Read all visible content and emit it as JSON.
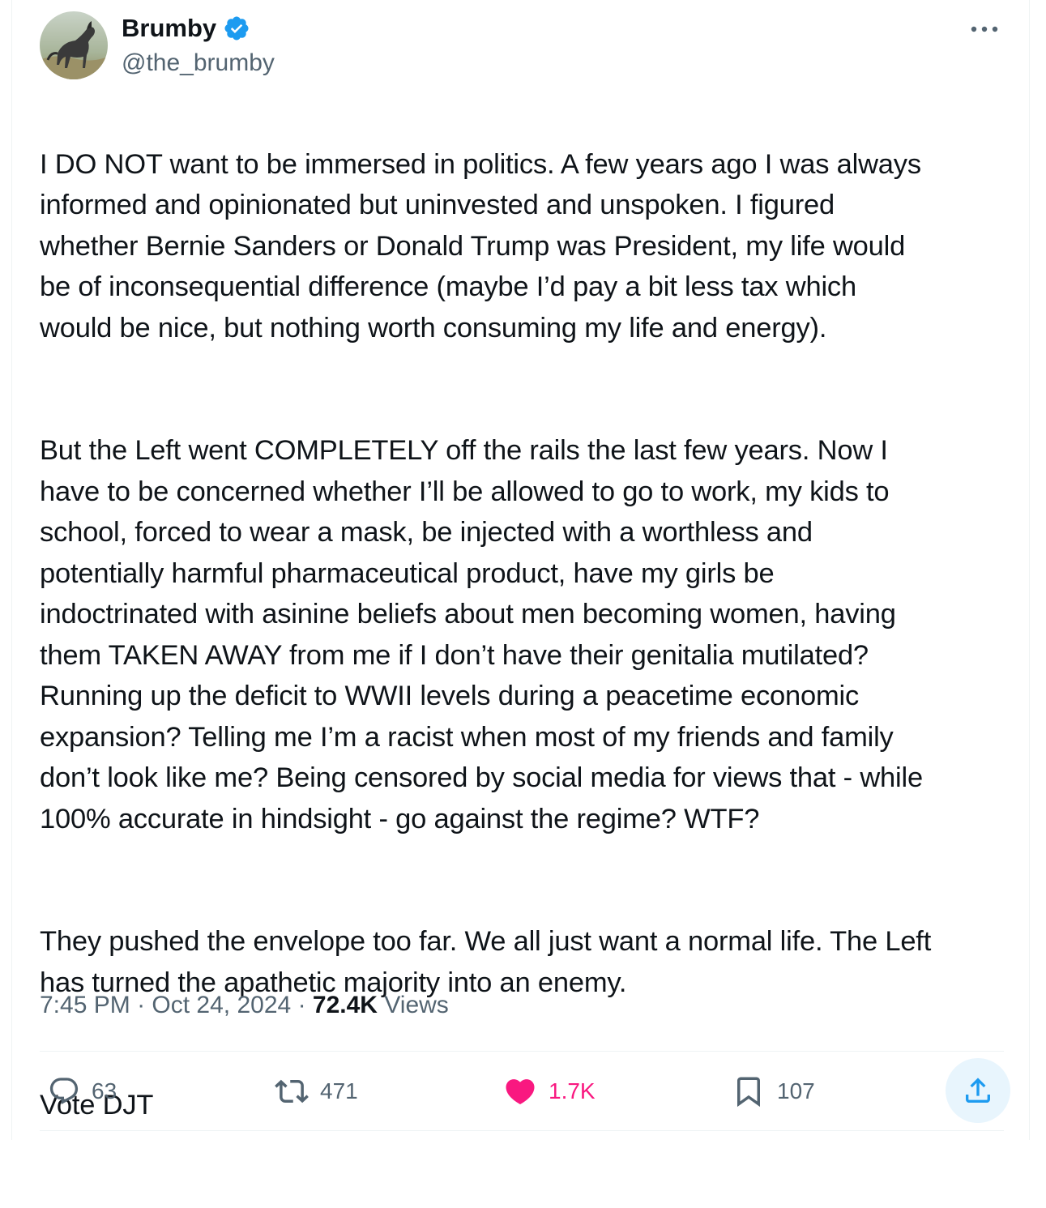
{
  "author": {
    "display_name": "Brumby",
    "handle": "@the_brumby",
    "verified": true
  },
  "tweet": {
    "paragraphs": [
      "I DO NOT want to be immersed in politics. A few years ago I was always\ninformed and opinionated but uninvested and unspoken. I figured\nwhether Bernie Sanders or Donald Trump was President, my life would\nbe of inconsequential difference (maybe I’d pay a bit less tax which\nwould be nice, but nothing worth consuming my life and energy).",
      "But the Left went COMPLETELY off the rails the last few years. Now I\nhave to be concerned whether I’ll be allowed to go to work, my kids to\nschool, forced to wear a mask, be injected with a worthless and\npotentially harmful pharmaceutical product, have my girls be\nindoctrinated with asinine beliefs about men becoming women, having\nthem TAKEN AWAY from me if I don’t have their genitalia mutilated?\nRunning up the deficit to WWII levels during a peacetime economic\nexpansion? Telling me I’m a racist when most of my friends and family\ndon’t look like me? Being censored by social media for views that - while\n100% accurate in hindsight - go against the regime? WTF?",
      "They pushed the envelope too far. We all just want a normal life. The Left\nhas turned the apathetic majority into an enemy.",
      "Vote DJT"
    ],
    "time": "7:45 PM",
    "separator": "·",
    "date": "Oct 24, 2024",
    "views_count": "72.4K",
    "views_label": "Views"
  },
  "actions": {
    "replies": "63",
    "reposts": "471",
    "likes": "1.7K",
    "bookmarks": "107"
  },
  "colors": {
    "text": "#0f1419",
    "secondary": "#536471",
    "verified": "#1d9bf0",
    "like": "#f91880",
    "share_bg": "#e8f5fd",
    "divider": "#eff3f4"
  },
  "icons": {
    "more": "more-horizontal-icon",
    "reply": "reply-icon",
    "repost": "repost-icon",
    "like": "heart-filled-icon",
    "bookmark": "bookmark-icon",
    "share": "share-icon"
  }
}
